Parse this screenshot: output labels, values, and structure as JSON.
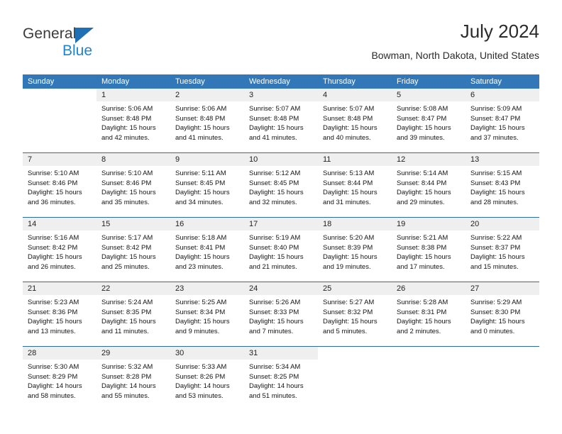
{
  "brand": {
    "name_part1": "General",
    "name_part2": "Blue",
    "triangle_color": "#1f6fb4",
    "blue_color": "#2084d0"
  },
  "header": {
    "title": "July 2024",
    "location": "Bowman, North Dakota, United States"
  },
  "theme": {
    "header_bar_color": "#3278b9",
    "week_divider_color": "#2d6ca8",
    "daynum_strip_color": "#efefef"
  },
  "weekdays": [
    "Sunday",
    "Monday",
    "Tuesday",
    "Wednesday",
    "Thursday",
    "Friday",
    "Saturday"
  ],
  "labels": {
    "sunrise": "Sunrise:",
    "sunset": "Sunset:",
    "daylight": "Daylight:"
  },
  "weeks": [
    {
      "days": [
        {
          "num": "",
          "sunrise": "",
          "sunset": "",
          "daylight_line1": "",
          "daylight_line2": "",
          "empty": true
        },
        {
          "num": "1",
          "sunrise": "Sunrise: 5:06 AM",
          "sunset": "Sunset: 8:48 PM",
          "daylight_line1": "Daylight: 15 hours",
          "daylight_line2": "and 42 minutes."
        },
        {
          "num": "2",
          "sunrise": "Sunrise: 5:06 AM",
          "sunset": "Sunset: 8:48 PM",
          "daylight_line1": "Daylight: 15 hours",
          "daylight_line2": "and 41 minutes."
        },
        {
          "num": "3",
          "sunrise": "Sunrise: 5:07 AM",
          "sunset": "Sunset: 8:48 PM",
          "daylight_line1": "Daylight: 15 hours",
          "daylight_line2": "and 41 minutes."
        },
        {
          "num": "4",
          "sunrise": "Sunrise: 5:07 AM",
          "sunset": "Sunset: 8:48 PM",
          "daylight_line1": "Daylight: 15 hours",
          "daylight_line2": "and 40 minutes."
        },
        {
          "num": "5",
          "sunrise": "Sunrise: 5:08 AM",
          "sunset": "Sunset: 8:47 PM",
          "daylight_line1": "Daylight: 15 hours",
          "daylight_line2": "and 39 minutes."
        },
        {
          "num": "6",
          "sunrise": "Sunrise: 5:09 AM",
          "sunset": "Sunset: 8:47 PM",
          "daylight_line1": "Daylight: 15 hours",
          "daylight_line2": "and 37 minutes."
        }
      ]
    },
    {
      "days": [
        {
          "num": "7",
          "sunrise": "Sunrise: 5:10 AM",
          "sunset": "Sunset: 8:46 PM",
          "daylight_line1": "Daylight: 15 hours",
          "daylight_line2": "and 36 minutes."
        },
        {
          "num": "8",
          "sunrise": "Sunrise: 5:10 AM",
          "sunset": "Sunset: 8:46 PM",
          "daylight_line1": "Daylight: 15 hours",
          "daylight_line2": "and 35 minutes."
        },
        {
          "num": "9",
          "sunrise": "Sunrise: 5:11 AM",
          "sunset": "Sunset: 8:45 PM",
          "daylight_line1": "Daylight: 15 hours",
          "daylight_line2": "and 34 minutes."
        },
        {
          "num": "10",
          "sunrise": "Sunrise: 5:12 AM",
          "sunset": "Sunset: 8:45 PM",
          "daylight_line1": "Daylight: 15 hours",
          "daylight_line2": "and 32 minutes."
        },
        {
          "num": "11",
          "sunrise": "Sunrise: 5:13 AM",
          "sunset": "Sunset: 8:44 PM",
          "daylight_line1": "Daylight: 15 hours",
          "daylight_line2": "and 31 minutes."
        },
        {
          "num": "12",
          "sunrise": "Sunrise: 5:14 AM",
          "sunset": "Sunset: 8:44 PM",
          "daylight_line1": "Daylight: 15 hours",
          "daylight_line2": "and 29 minutes."
        },
        {
          "num": "13",
          "sunrise": "Sunrise: 5:15 AM",
          "sunset": "Sunset: 8:43 PM",
          "daylight_line1": "Daylight: 15 hours",
          "daylight_line2": "and 28 minutes."
        }
      ]
    },
    {
      "days": [
        {
          "num": "14",
          "sunrise": "Sunrise: 5:16 AM",
          "sunset": "Sunset: 8:42 PM",
          "daylight_line1": "Daylight: 15 hours",
          "daylight_line2": "and 26 minutes."
        },
        {
          "num": "15",
          "sunrise": "Sunrise: 5:17 AM",
          "sunset": "Sunset: 8:42 PM",
          "daylight_line1": "Daylight: 15 hours",
          "daylight_line2": "and 25 minutes."
        },
        {
          "num": "16",
          "sunrise": "Sunrise: 5:18 AM",
          "sunset": "Sunset: 8:41 PM",
          "daylight_line1": "Daylight: 15 hours",
          "daylight_line2": "and 23 minutes."
        },
        {
          "num": "17",
          "sunrise": "Sunrise: 5:19 AM",
          "sunset": "Sunset: 8:40 PM",
          "daylight_line1": "Daylight: 15 hours",
          "daylight_line2": "and 21 minutes."
        },
        {
          "num": "18",
          "sunrise": "Sunrise: 5:20 AM",
          "sunset": "Sunset: 8:39 PM",
          "daylight_line1": "Daylight: 15 hours",
          "daylight_line2": "and 19 minutes."
        },
        {
          "num": "19",
          "sunrise": "Sunrise: 5:21 AM",
          "sunset": "Sunset: 8:38 PM",
          "daylight_line1": "Daylight: 15 hours",
          "daylight_line2": "and 17 minutes."
        },
        {
          "num": "20",
          "sunrise": "Sunrise: 5:22 AM",
          "sunset": "Sunset: 8:37 PM",
          "daylight_line1": "Daylight: 15 hours",
          "daylight_line2": "and 15 minutes."
        }
      ]
    },
    {
      "days": [
        {
          "num": "21",
          "sunrise": "Sunrise: 5:23 AM",
          "sunset": "Sunset: 8:36 PM",
          "daylight_line1": "Daylight: 15 hours",
          "daylight_line2": "and 13 minutes."
        },
        {
          "num": "22",
          "sunrise": "Sunrise: 5:24 AM",
          "sunset": "Sunset: 8:35 PM",
          "daylight_line1": "Daylight: 15 hours",
          "daylight_line2": "and 11 minutes."
        },
        {
          "num": "23",
          "sunrise": "Sunrise: 5:25 AM",
          "sunset": "Sunset: 8:34 PM",
          "daylight_line1": "Daylight: 15 hours",
          "daylight_line2": "and 9 minutes."
        },
        {
          "num": "24",
          "sunrise": "Sunrise: 5:26 AM",
          "sunset": "Sunset: 8:33 PM",
          "daylight_line1": "Daylight: 15 hours",
          "daylight_line2": "and 7 minutes."
        },
        {
          "num": "25",
          "sunrise": "Sunrise: 5:27 AM",
          "sunset": "Sunset: 8:32 PM",
          "daylight_line1": "Daylight: 15 hours",
          "daylight_line2": "and 5 minutes."
        },
        {
          "num": "26",
          "sunrise": "Sunrise: 5:28 AM",
          "sunset": "Sunset: 8:31 PM",
          "daylight_line1": "Daylight: 15 hours",
          "daylight_line2": "and 2 minutes."
        },
        {
          "num": "27",
          "sunrise": "Sunrise: 5:29 AM",
          "sunset": "Sunset: 8:30 PM",
          "daylight_line1": "Daylight: 15 hours",
          "daylight_line2": "and 0 minutes."
        }
      ]
    },
    {
      "days": [
        {
          "num": "28",
          "sunrise": "Sunrise: 5:30 AM",
          "sunset": "Sunset: 8:29 PM",
          "daylight_line1": "Daylight: 14 hours",
          "daylight_line2": "and 58 minutes."
        },
        {
          "num": "29",
          "sunrise": "Sunrise: 5:32 AM",
          "sunset": "Sunset: 8:28 PM",
          "daylight_line1": "Daylight: 14 hours",
          "daylight_line2": "and 55 minutes."
        },
        {
          "num": "30",
          "sunrise": "Sunrise: 5:33 AM",
          "sunset": "Sunset: 8:26 PM",
          "daylight_line1": "Daylight: 14 hours",
          "daylight_line2": "and 53 minutes."
        },
        {
          "num": "31",
          "sunrise": "Sunrise: 5:34 AM",
          "sunset": "Sunset: 8:25 PM",
          "daylight_line1": "Daylight: 14 hours",
          "daylight_line2": "and 51 minutes."
        },
        {
          "num": "",
          "sunrise": "",
          "sunset": "",
          "daylight_line1": "",
          "daylight_line2": "",
          "empty": true
        },
        {
          "num": "",
          "sunrise": "",
          "sunset": "",
          "daylight_line1": "",
          "daylight_line2": "",
          "empty": true
        },
        {
          "num": "",
          "sunrise": "",
          "sunset": "",
          "daylight_line1": "",
          "daylight_line2": "",
          "empty": true
        }
      ]
    }
  ]
}
